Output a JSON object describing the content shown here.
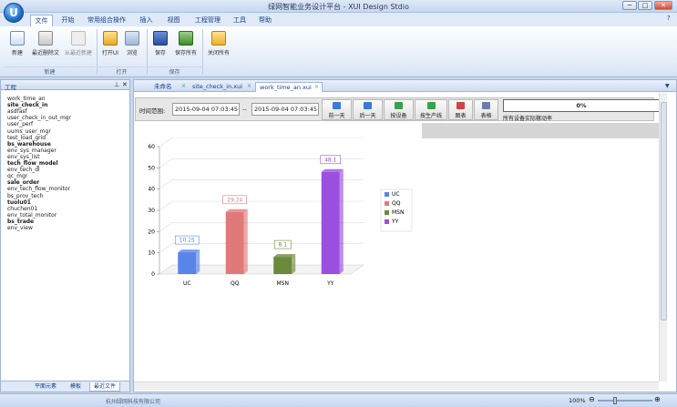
{
  "window": {
    "logo_letter": "U",
    "title": "绿网智能业务设计平台 - XUI Design Stdio",
    "controls": {
      "minimize": "─",
      "maximize": "□",
      "close": "✕"
    }
  },
  "menu": {
    "tabs": [
      "文件",
      "开始",
      "常用组合操作",
      "插入",
      "视图",
      "工程管理",
      "工具",
      "帮助"
    ],
    "active": "文件",
    "right_icons": {
      "help": "?",
      "min": "▭",
      "close": "✕"
    }
  },
  "ribbon": {
    "buttons": [
      "新建",
      "最近删除文",
      "从最近新建",
      "打开UI",
      "浏览",
      "保存",
      "保存所有",
      "关闭所有"
    ],
    "groups": [
      "新建",
      "打开",
      "保存",
      ""
    ]
  },
  "left_panel": {
    "title": "工程",
    "pin": "⊥",
    "close": "✕",
    "items": [
      "work_time_an",
      "site_check_in",
      "asdfasf",
      "user_check_in_out_mgr",
      "user_perf",
      "uums_user_mgr",
      "test_load_grid",
      "bs_warehouse",
      "env_sys_manager",
      "env_sys_list",
      "tech_flow_model",
      "env_tech_dl",
      "qc_mgr",
      "sale_order",
      "env_tech_flow_monitor",
      "bs_prov_tech",
      "tuolu01",
      "chuchen01",
      "env_total_monitor",
      "bs_trade",
      "env_view"
    ],
    "bold_items": [
      "site_check_in",
      "bs_warehouse",
      "tech_flow_model",
      "sale_order",
      "tuolu01",
      "bs_trade"
    ],
    "tabs": [
      "平面元素",
      "模板",
      "最近文件"
    ],
    "active_tab": "最近文件"
  },
  "doc_tabs": {
    "tabs": [
      "未命名",
      "site_check_in.xui",
      "work_time_an.xui"
    ],
    "active": "work_time_an.xui",
    "close_glyph": "×",
    "menu_arrow": "▼"
  },
  "toolbar": {
    "range_label": "时间范围:",
    "start": "2015-09-04 07:03:45",
    "separator": "--",
    "end": "2015-09-04 07:03:45",
    "buttons": [
      "前一天",
      "后一天",
      "按设备",
      "按生产线",
      "图表",
      "表格"
    ],
    "status_box": "0%",
    "status_text": "所有设备实际稼动率"
  },
  "chart_data": {
    "type": "bar",
    "categories": [
      "UC",
      "QQ",
      "MSN",
      "YY"
    ],
    "values": [
      10.25,
      29.24,
      8.1,
      48.1
    ],
    "value_labels": [
      "10.25",
      "29.24",
      "8.1",
      "48.1"
    ],
    "ylim": [
      0,
      60
    ],
    "yticks": [
      0,
      10,
      20,
      30,
      40,
      50,
      60
    ],
    "grid": true,
    "legend_position": "right",
    "colors": [
      "#5a84e8",
      "#e07a7a",
      "#6b8a3a",
      "#9b4fe0"
    ],
    "legend": [
      "UC",
      "QQ",
      "MSN",
      "YY"
    ]
  },
  "status_bar": {
    "left_text": "杭州绿网科技有限公司",
    "zoom": "100%",
    "zoom_minus": "⊖",
    "zoom_plus": "⊕"
  }
}
